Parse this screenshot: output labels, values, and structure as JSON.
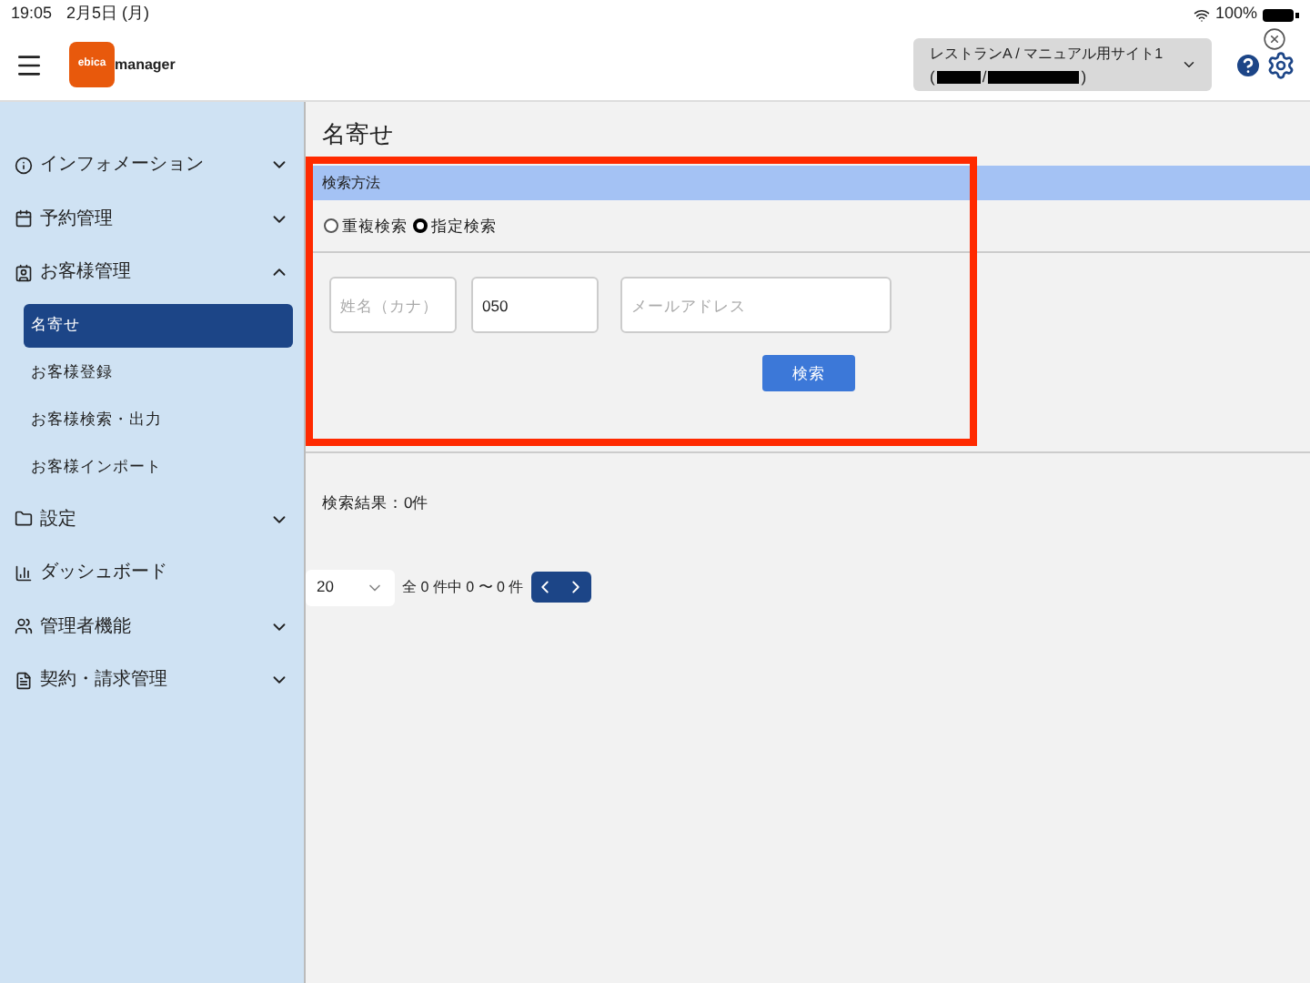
{
  "status_bar": {
    "time": "19:05",
    "date": "2月5日 (月)",
    "battery": "100%"
  },
  "header": {
    "logo_badge": "ebica",
    "logo_text": "manager",
    "site_selector": {
      "label": "レストランA / マニュアル用サイト1",
      "detail_open": "(",
      "detail_sep": "/",
      "detail_close": ")"
    }
  },
  "sidebar": {
    "items": [
      {
        "kind": "group",
        "label": "インフォメーション",
        "expanded": false
      },
      {
        "kind": "group",
        "label": "予約管理",
        "expanded": false
      },
      {
        "kind": "group",
        "label": "お客様管理",
        "expanded": true,
        "children": [
          {
            "label": "名寄せ",
            "selected": true
          },
          {
            "label": "お客様登録",
            "selected": false
          },
          {
            "label": "お客様検索・出力",
            "selected": false
          },
          {
            "label": "お客様インポート",
            "selected": false
          }
        ]
      },
      {
        "kind": "group",
        "label": "設定",
        "expanded": false
      },
      {
        "kind": "link",
        "label": "ダッシュボード"
      },
      {
        "kind": "group",
        "label": "管理者機能",
        "expanded": false
      },
      {
        "kind": "group",
        "label": "契約・請求管理",
        "expanded": false
      }
    ]
  },
  "main": {
    "title": "名寄せ",
    "section_title": "検索方法",
    "search_modes": [
      {
        "label": "重複検索",
        "selected": false
      },
      {
        "label": "指定検索",
        "selected": true
      }
    ],
    "fields": [
      {
        "placeholder": "姓名（カナ）"
      },
      {
        "value": "050"
      },
      {
        "placeholder": "メールアドレス"
      }
    ],
    "search_button": "検索",
    "result_text": "検索結果：0件",
    "pagination": {
      "page_size": "20",
      "summary": "全 0 件中 0 〜 0 件"
    }
  }
}
